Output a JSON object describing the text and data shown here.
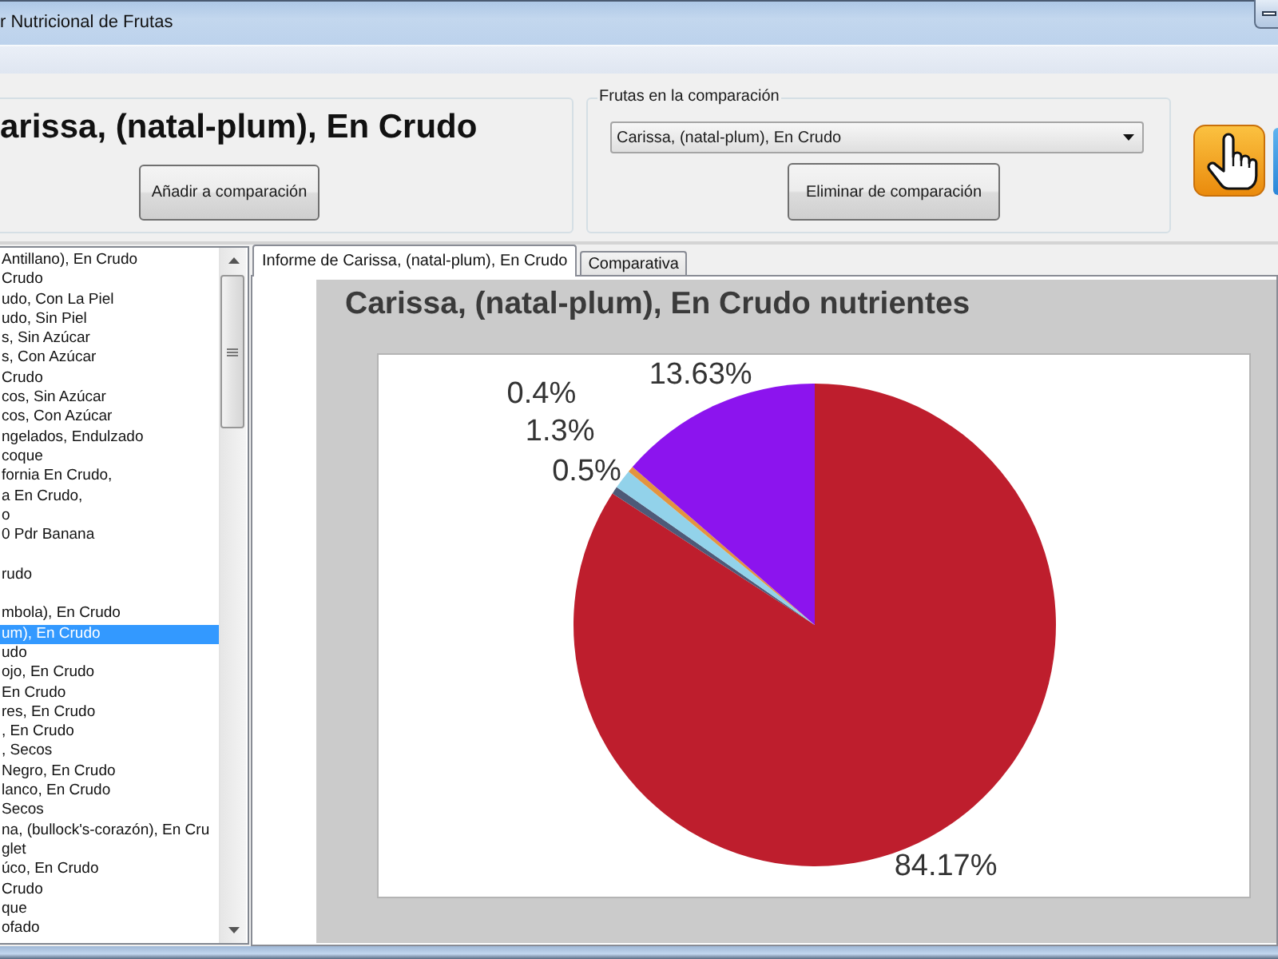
{
  "window": {
    "title": "r Nutricional de Frutas"
  },
  "fruit_panel": {
    "heading": "arissa, (natal-plum), En Crudo",
    "add_button": "Añadir a comparación"
  },
  "comparison": {
    "legend": "Frutas en la comparación",
    "dropdown": {
      "value": "Carissa, (natal-plum), En Crudo"
    },
    "remove_button": "Eliminar de comparación"
  },
  "fruit_list": {
    "items": [
      {
        "text": "Antillano), En Crudo",
        "selected": false
      },
      {
        "text": "Crudo",
        "selected": false
      },
      {
        "text": "udo, Con La Piel",
        "selected": false
      },
      {
        "text": "udo, Sin Piel",
        "selected": false
      },
      {
        "text": "s, Sin Azúcar",
        "selected": false
      },
      {
        "text": "s, Con Azúcar",
        "selected": false
      },
      {
        "text": "Crudo",
        "selected": false
      },
      {
        "text": "cos, Sin Azúcar",
        "selected": false
      },
      {
        "text": "cos, Con Azúcar",
        "selected": false
      },
      {
        "text": "ngelados, Endulzado",
        "selected": false
      },
      {
        "text": "coque",
        "selected": false
      },
      {
        "text": "fornia En Crudo,",
        "selected": false
      },
      {
        "text": "a En Crudo,",
        "selected": false
      },
      {
        "text": "o",
        "selected": false
      },
      {
        "text": "0 Pdr Banana",
        "selected": false
      },
      {
        "selected": false
      },
      {
        "text": "rudo",
        "selected": false
      },
      {
        "selected": false
      },
      {
        "text": "mbola), En Crudo",
        "selected": false
      },
      {
        "text": "um), En Crudo",
        "selected": true
      },
      {
        "text": "udo",
        "selected": false
      },
      {
        "text": "ojo, En Crudo",
        "selected": false
      },
      {
        "text": "En Crudo",
        "selected": false
      },
      {
        "text": "res, En Crudo",
        "selected": false
      },
      {
        "text": ", En Crudo",
        "selected": false
      },
      {
        "text": ", Secos",
        "selected": false
      },
      {
        "text": "Negro, En Crudo",
        "selected": false
      },
      {
        "text": "lanco, En Crudo",
        "selected": false
      },
      {
        "text": "Secos",
        "selected": false
      },
      {
        "text": "na, (bullock's-corazón), En Cru",
        "selected": false
      },
      {
        "text": "glet",
        "selected": false
      },
      {
        "text": "úco, En Crudo",
        "selected": false
      },
      {
        "text": "Crudo",
        "selected": false
      },
      {
        "text": "que",
        "selected": false
      },
      {
        "text": "ofado",
        "selected": false
      }
    ]
  },
  "tabs": [
    {
      "label": "Informe de Carissa, (natal-plum), En Crudo",
      "selected": true
    },
    {
      "label": "Comparativa",
      "selected": false
    }
  ],
  "report": {
    "chart_data": {
      "type": "pie",
      "title": "Carissa, (natal-plum), En Crudo nutrientes",
      "values": [
        84.17,
        0.5,
        1.3,
        0.4,
        13.63
      ],
      "value_labels": [
        "84.17%",
        "0.5%",
        "1.3%",
        "0.4%",
        "13.63%"
      ]
    }
  }
}
